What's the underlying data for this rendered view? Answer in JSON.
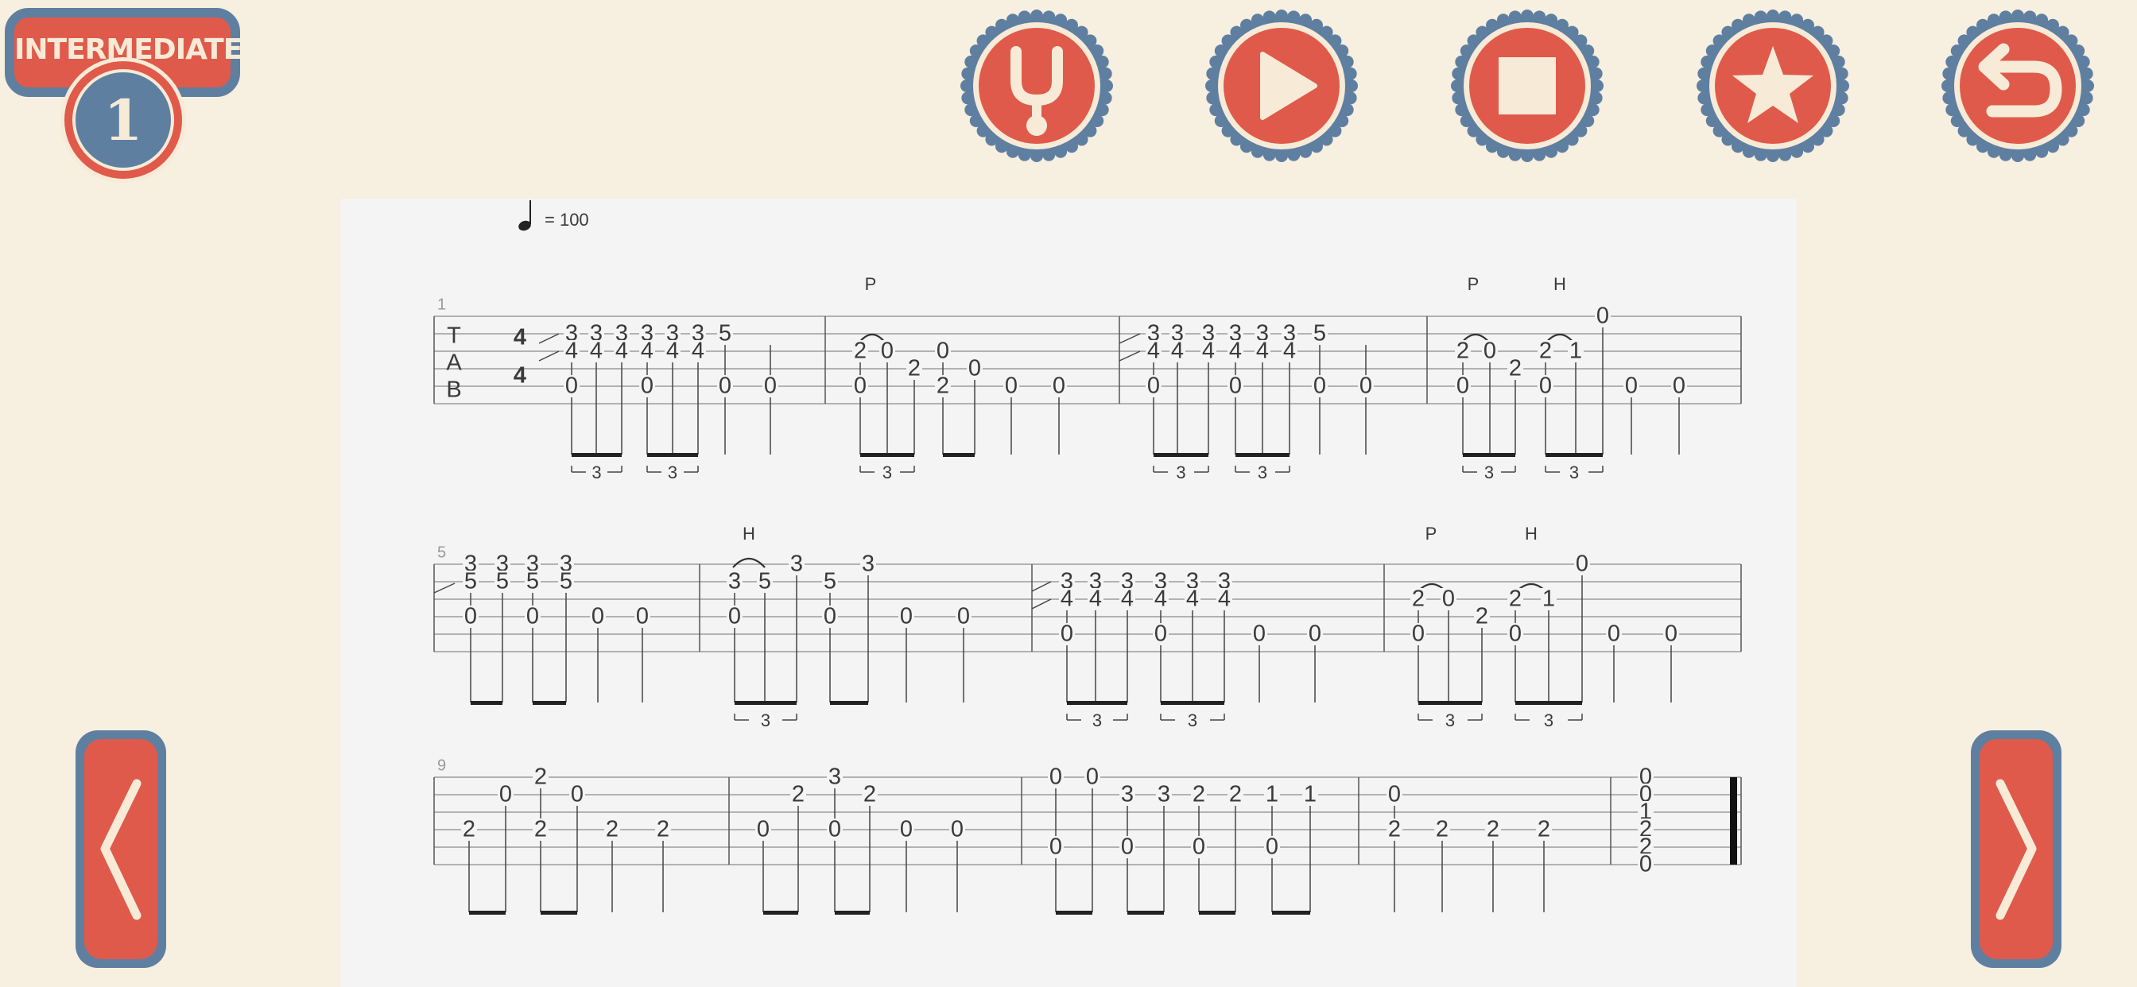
{
  "level": {
    "label": "INTERMEDIATE",
    "number": "1"
  },
  "toolbar": {
    "tuner_icon": "tuning-fork-icon",
    "play_icon": "play-icon",
    "stop_icon": "stop-icon",
    "favorite_icon": "star-icon",
    "back_icon": "return-icon"
  },
  "navigation": {
    "prev_icon": "chevron-left-icon",
    "next_icon": "chevron-right-icon"
  },
  "colors": {
    "background": "#f7efdf",
    "accent_red": "#e05a4b",
    "accent_blue": "#5f7fa1",
    "cream": "#f7ebd7",
    "sheet": "#f4f4f4"
  },
  "score": {
    "tempo_value": "= 100",
    "clef": [
      "T",
      "A",
      "B"
    ],
    "time_signature": [
      "4",
      "4"
    ],
    "tuplet_label": "3",
    "measure_numbers": [
      "1",
      "5",
      "9"
    ],
    "techniques": [
      "P",
      "P",
      "H",
      "H",
      "P",
      "H"
    ],
    "systems": [
      [
        [
          "3",
          "4",
          "0",
          "3",
          "4",
          "3",
          "4",
          "0",
          "3",
          "4",
          "3",
          "4",
          "0",
          "3",
          "4",
          "5",
          "0",
          "0"
        ],
        [
          "2",
          "0",
          "0",
          "2",
          "0",
          "2",
          "0",
          "0"
        ],
        [
          "3",
          "4",
          "0",
          "3",
          "4",
          "3",
          "4",
          "0",
          "3",
          "4",
          "3",
          "4",
          "0",
          "3",
          "4",
          "5",
          "0",
          "0"
        ],
        [
          "2",
          "0",
          "0",
          "2",
          "0",
          "1",
          "0",
          "0",
          "0",
          "0"
        ]
      ],
      [
        [
          "3",
          "5",
          "0",
          "3",
          "5",
          "3",
          "5",
          "0",
          "3",
          "5",
          "0",
          "0"
        ],
        [
          "3",
          "5",
          "0",
          "3",
          "5",
          "0",
          "3",
          "0",
          "0"
        ],
        [
          "3",
          "4",
          "0",
          "3",
          "4",
          "3",
          "4",
          "0",
          "3",
          "4",
          "3",
          "4",
          "3",
          "4",
          "0",
          "0"
        ],
        [
          "2",
          "0",
          "0",
          "2",
          "0",
          "1",
          "0",
          "0",
          "0",
          "0"
        ]
      ],
      [
        [
          "2",
          "0",
          "2",
          "2",
          "0",
          "2",
          "2"
        ],
        [
          "0",
          "2",
          "3",
          "0",
          "2",
          "0",
          "0"
        ],
        [
          "0",
          "0",
          "0",
          "0",
          "3",
          "0",
          "3",
          "0",
          "2",
          "0",
          "2",
          "1",
          "1"
        ],
        [
          "0",
          "2",
          "2",
          "2",
          "2"
        ],
        [
          "0",
          "0",
          "1",
          "2",
          "2",
          "0"
        ]
      ]
    ]
  }
}
